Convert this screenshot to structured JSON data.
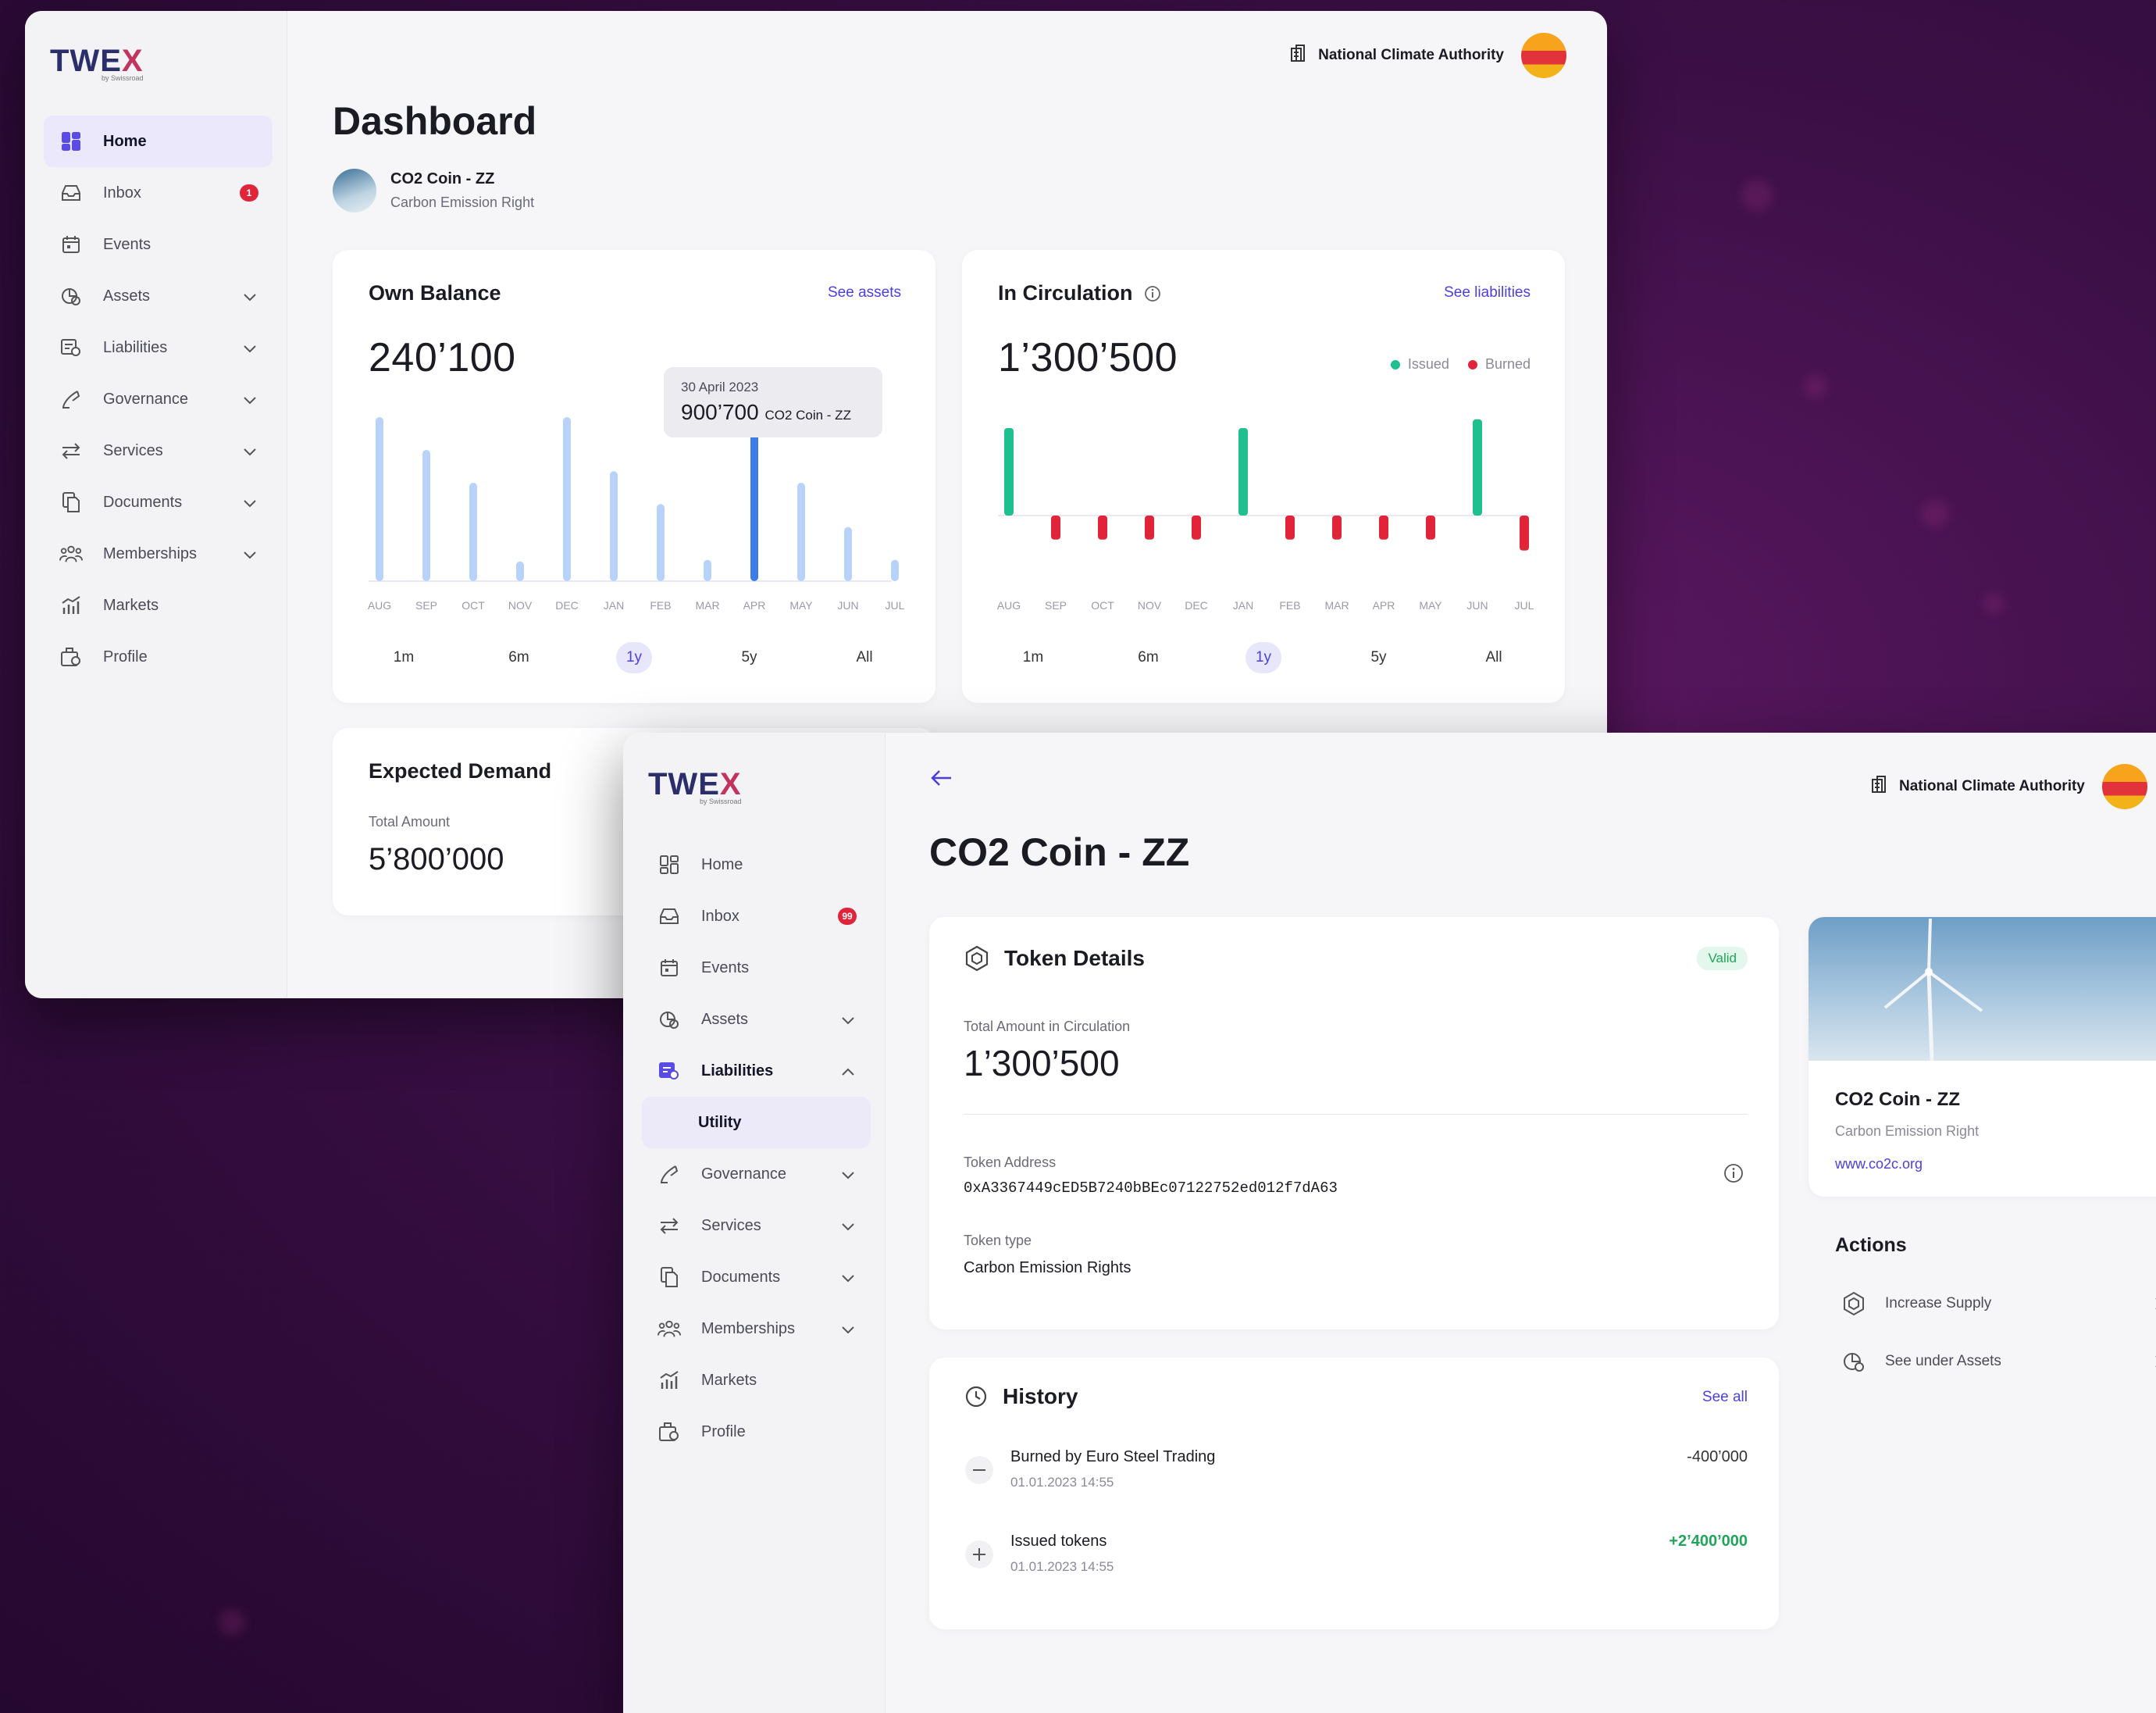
{
  "window1": {
    "logo": "TWEX",
    "logo_sub": "by Swissroad",
    "nav": [
      {
        "label": "Home",
        "icon": "grid-icon",
        "active": true
      },
      {
        "label": "Inbox",
        "icon": "inbox-icon",
        "badge": "1"
      },
      {
        "label": "Events",
        "icon": "calendar-icon"
      },
      {
        "label": "Assets",
        "icon": "assets-icon",
        "chevron": "down"
      },
      {
        "label": "Liabilities",
        "icon": "liabilities-icon",
        "chevron": "down"
      },
      {
        "label": "Governance",
        "icon": "governance-icon",
        "chevron": "down"
      },
      {
        "label": "Services",
        "icon": "services-icon",
        "chevron": "down"
      },
      {
        "label": "Documents",
        "icon": "documents-icon",
        "chevron": "down"
      },
      {
        "label": "Memberships",
        "icon": "memberships-icon",
        "chevron": "down"
      },
      {
        "label": "Markets",
        "icon": "markets-icon"
      },
      {
        "label": "Profile",
        "icon": "profile-icon"
      }
    ],
    "org": "National Climate Authority",
    "page_title": "Dashboard",
    "token": {
      "name": "CO2 Coin - ZZ",
      "type": "Carbon Emission Right"
    },
    "own_balance": {
      "title": "Own Balance",
      "link": "See assets",
      "value": "240’100",
      "tooltip_date": "30 April 2023",
      "tooltip_value": "900’700",
      "tooltip_unit": "CO2 Coin - ZZ",
      "ranges": [
        "1m",
        "6m",
        "1y",
        "5y",
        "All"
      ],
      "selected_range": "1y"
    },
    "in_circulation": {
      "title": "In Circulation",
      "link": "See liabilities",
      "value": "1’300’500",
      "legend": [
        {
          "label": "Issued",
          "color": "#1fbf8f"
        },
        {
          "label": "Burned",
          "color": "#e0243a"
        }
      ],
      "ranges": [
        "1m",
        "6m",
        "1y",
        "5y",
        "All"
      ],
      "selected_range": "1y"
    },
    "expected_demand": {
      "title": "Expected Demand",
      "label": "Total Amount",
      "value": "5’800’000"
    }
  },
  "window2": {
    "logo": "TWEX",
    "logo_sub": "by Swissroad",
    "nav": [
      {
        "label": "Home",
        "icon": "grid-icon"
      },
      {
        "label": "Inbox",
        "icon": "inbox-icon",
        "badge": "99"
      },
      {
        "label": "Events",
        "icon": "calendar-icon"
      },
      {
        "label": "Assets",
        "icon": "assets-icon",
        "chevron": "down"
      },
      {
        "label": "Liabilities",
        "icon": "liabilities-icon",
        "chevron": "up",
        "active_parent": true
      },
      {
        "label": "Utility",
        "sub": true
      },
      {
        "label": "Governance",
        "icon": "governance-icon",
        "chevron": "down"
      },
      {
        "label": "Services",
        "icon": "services-icon",
        "chevron": "down"
      },
      {
        "label": "Documents",
        "icon": "documents-icon",
        "chevron": "down"
      },
      {
        "label": "Memberships",
        "icon": "memberships-icon",
        "chevron": "down"
      },
      {
        "label": "Markets",
        "icon": "markets-icon"
      },
      {
        "label": "Profile",
        "icon": "profile-icon"
      }
    ],
    "org": "National Climate Authority",
    "page_title": "CO2 Coin - ZZ",
    "token_details": {
      "title": "Token Details",
      "status": "Valid",
      "amount_label": "Total Amount in Circulation",
      "amount": "1’300’500",
      "address_label": "Token Address",
      "address": "0xA3367449cED5B7240bBEc07122752ed012f7dA63",
      "type_label": "Token type",
      "type": "Carbon Emission Rights"
    },
    "history": {
      "title": "History",
      "link": "See all",
      "items": [
        {
          "label": "Burned by Euro Steel Trading",
          "time": "01.01.2023 14:55",
          "amount": "-400’000",
          "sign": "minus"
        },
        {
          "label": "Issued tokens",
          "time": "01.01.2023 14:55",
          "amount": "+2’400’000",
          "sign": "plus"
        }
      ]
    },
    "side_card": {
      "name": "CO2 Coin - ZZ",
      "type": "Carbon Emission Right",
      "url": "www.co2c.org"
    },
    "actions": {
      "title": "Actions",
      "items": [
        {
          "label": "Increase Supply"
        },
        {
          "label": "See under Assets"
        }
      ]
    }
  },
  "chart_data": [
    {
      "type": "bar",
      "title": "Own Balance",
      "categories": [
        "AUG",
        "SEP",
        "OCT",
        "NOV",
        "DEC",
        "JAN",
        "FEB",
        "MAR",
        "APR",
        "MAY",
        "JUN",
        "JUL"
      ],
      "values": [
        100,
        80,
        60,
        12,
        100,
        67,
        47,
        13,
        93,
        60,
        33,
        13
      ],
      "highlight": "APR",
      "colors": {
        "bar": "#b7d3fb",
        "highlight": "#3c7be8"
      }
    },
    {
      "type": "bar",
      "title": "In Circulation",
      "categories": [
        "AUG",
        "SEP",
        "OCT",
        "NOV",
        "DEC",
        "JAN",
        "FEB",
        "MAR",
        "APR",
        "MAY",
        "JUN",
        "JUL"
      ],
      "series": [
        {
          "name": "Issued",
          "values": [
            80,
            0,
            0,
            0,
            0,
            80,
            0,
            0,
            0,
            0,
            88,
            0
          ]
        },
        {
          "name": "Burned",
          "values": [
            0,
            22,
            22,
            22,
            22,
            0,
            22,
            22,
            22,
            22,
            0,
            32
          ]
        }
      ]
    }
  ]
}
